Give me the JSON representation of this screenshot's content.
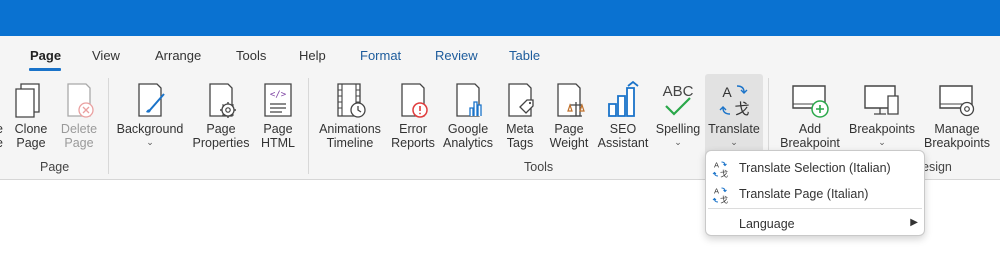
{
  "tabs": [
    {
      "label": "Page"
    },
    {
      "label": "View"
    },
    {
      "label": "Arrange"
    },
    {
      "label": "Tools"
    },
    {
      "label": "Help"
    },
    {
      "label": "Format"
    },
    {
      "label": "Review"
    },
    {
      "label": "Table"
    }
  ],
  "ribbon": {
    "page_group": {
      "label": "Page",
      "edge_fragment": "e",
      "clone_page": {
        "line1": "Clone",
        "line2": "Page"
      },
      "delete_page": {
        "line1": "Delete",
        "line2": "Page"
      },
      "background": {
        "line1": "Background"
      },
      "page_properties": {
        "line1": "Page",
        "line2": "Properties"
      },
      "page_html": {
        "line1": "Page",
        "line2": "HTML"
      }
    },
    "tools_group": {
      "label": "Tools",
      "animations_timeline": {
        "line1": "Animations",
        "line2": "Timeline"
      },
      "error_reports": {
        "line1": "Error",
        "line2": "Reports"
      },
      "google_analytics": {
        "line1": "Google",
        "line2": "Analytics"
      },
      "meta_tags": {
        "line1": "Meta",
        "line2": "Tags"
      },
      "page_weight": {
        "line1": "Page",
        "line2": "Weight"
      },
      "seo_assistant": {
        "line1": "SEO",
        "line2": "Assistant"
      },
      "spelling": {
        "line1": "Spelling"
      },
      "translate": {
        "line1": "Translate"
      }
    },
    "design_group": {
      "label_fragment": "esign",
      "add_breakpoint": {
        "line1": "Add",
        "line2": "Breakpoint"
      },
      "breakpoints": {
        "line1": "Breakpoints"
      },
      "manage_breakpoints": {
        "line1": "Manage",
        "line2": "Breakpoints"
      }
    },
    "icon_text": {
      "abc": "ABC",
      "html_tag": "</>",
      "translate_latin": "A",
      "translate_cjk": "戈"
    }
  },
  "translate_menu": {
    "items": [
      {
        "label": "Translate Selection (Italian)"
      },
      {
        "label": "Translate Page (Italian)"
      },
      {
        "label": "Language"
      }
    ]
  },
  "colors": {
    "titlebar": "#0a72d1",
    "accent": "#1a73c9",
    "error": "#e03b3b",
    "check": "#2aa84a",
    "html_purple": "#7b3fa0"
  }
}
